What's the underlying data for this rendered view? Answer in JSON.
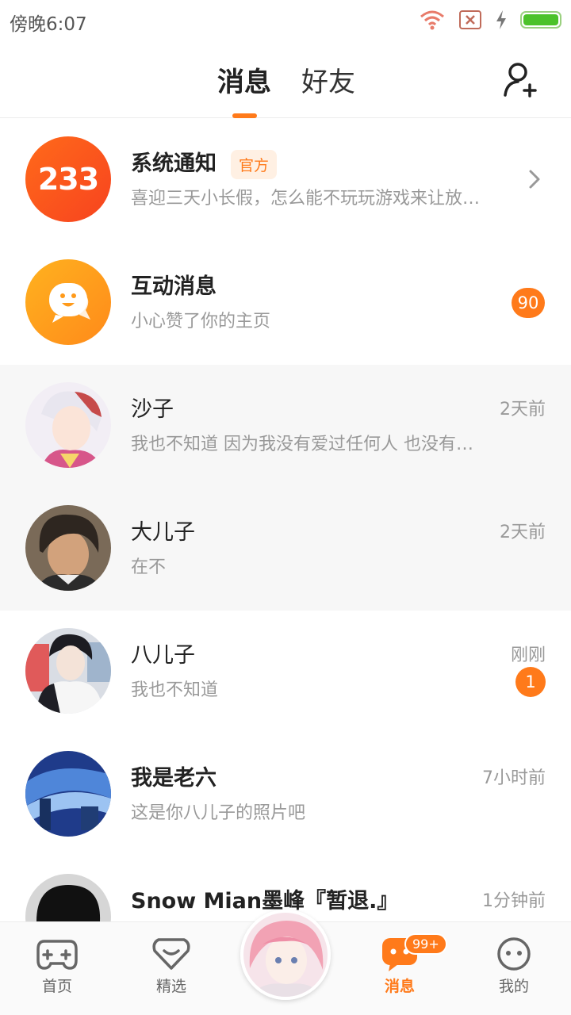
{
  "status_bar": {
    "time": "傍晚6:07"
  },
  "header": {
    "tabs": [
      {
        "label": "消息"
      },
      {
        "label": "好友"
      }
    ]
  },
  "conversations": [
    {
      "name": "系统通知",
      "tag": "官方",
      "preview": "喜迎三天小长假，怎么能不玩玩游戏来让放…",
      "time": ""
    },
    {
      "name": "互动消息",
      "preview": "小心赞了你的主页",
      "badge": "90"
    },
    {
      "name": "沙子",
      "preview": "我也不知道 因为我没有爱过任何人 也没有…",
      "time": "2天前"
    },
    {
      "name": "大儿子",
      "preview": "在不",
      "time": "2天前"
    },
    {
      "name": "八儿子",
      "preview": "我也不知道",
      "time": "刚刚",
      "badge": "1"
    },
    {
      "name": "我是老六",
      "preview": "这是你八儿子的照片吧",
      "time": "7小时前"
    },
    {
      "name": "Snow Mian墨峰『暂退.』",
      "preview": "",
      "time": "1分钟前"
    }
  ],
  "system_avatar_text": "233",
  "bottom_nav": {
    "items": [
      {
        "label": "首页"
      },
      {
        "label": "精选"
      },
      {
        "label": "消息"
      },
      {
        "label": "我的"
      }
    ],
    "messages_badge": "99+"
  },
  "colors": {
    "accent": "#ff7a1a"
  }
}
